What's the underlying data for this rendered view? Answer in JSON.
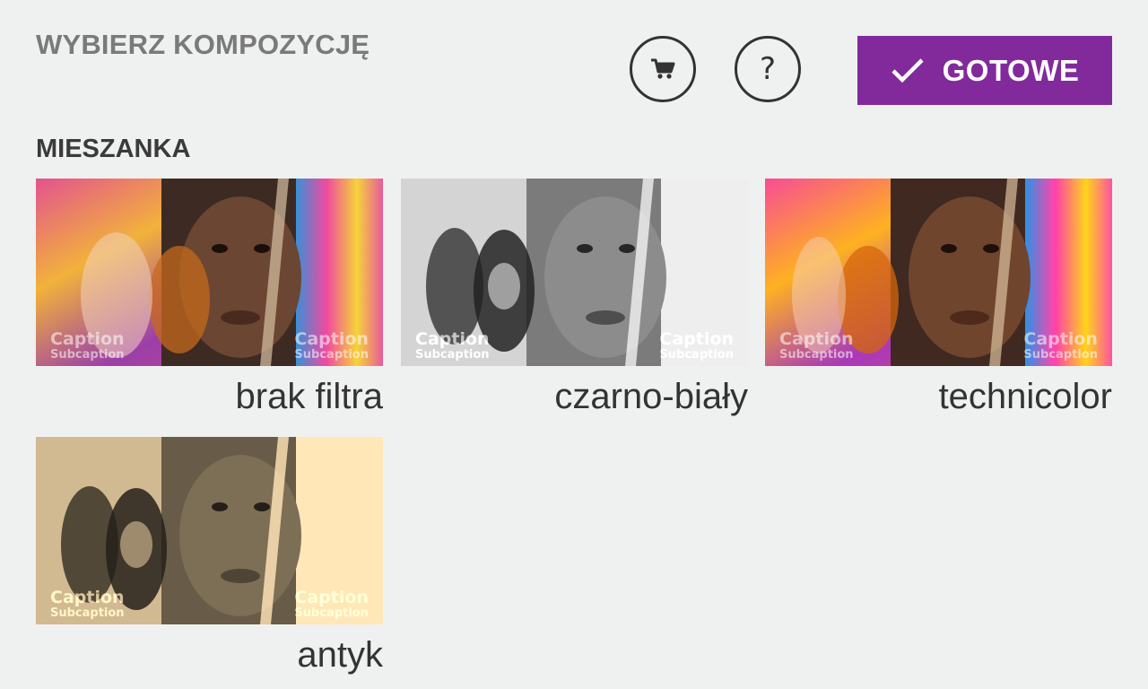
{
  "header": {
    "title": "WYBIERZ KOMPOZYCJĘ",
    "cart_icon": "cart-icon",
    "help_label": "?",
    "done_label": "GOTOWE",
    "done_icon": "check-icon",
    "accent": "#822a9c"
  },
  "section": {
    "title": "MIESZANKA"
  },
  "filters": [
    {
      "label": "brak filtra",
      "caption": "Caption",
      "subcaption": "Subcaption",
      "tone": "color"
    },
    {
      "label": "czarno-biały",
      "caption": "Caption",
      "subcaption": "Subcaption",
      "tone": "grayscale"
    },
    {
      "label": "technicolor",
      "caption": "Caption",
      "subcaption": "Subcaption",
      "tone": "color"
    },
    {
      "label": "antyk",
      "caption": "Caption",
      "subcaption": "Subcaption",
      "tone": "sepia"
    }
  ]
}
